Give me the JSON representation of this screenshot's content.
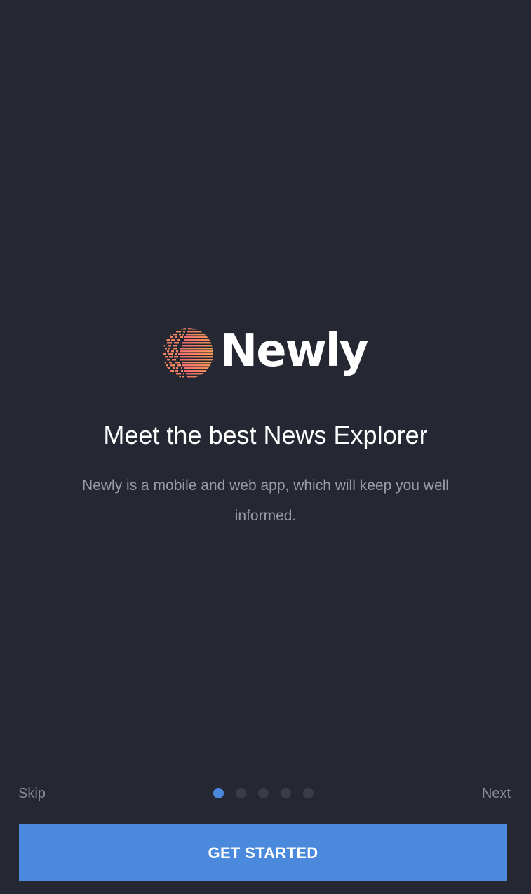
{
  "brand": {
    "name": "Newly",
    "logo_icon": "globe-stripes-icon",
    "logo_gradient": [
      "#f05a7a",
      "#f7b14a"
    ]
  },
  "onboarding": {
    "headline": "Meet the best News Explorer",
    "description": "Newly is a mobile and web app, which will keep you well informed.",
    "current_page": 1,
    "total_pages": 5
  },
  "nav": {
    "skip_label": "Skip",
    "next_label": "Next",
    "cta_label": "GET STARTED"
  },
  "colors": {
    "background": "#252733",
    "accent": "#4a89dc",
    "inactive_dot": "#3a3c48",
    "muted_text": "#9a9ca5"
  }
}
